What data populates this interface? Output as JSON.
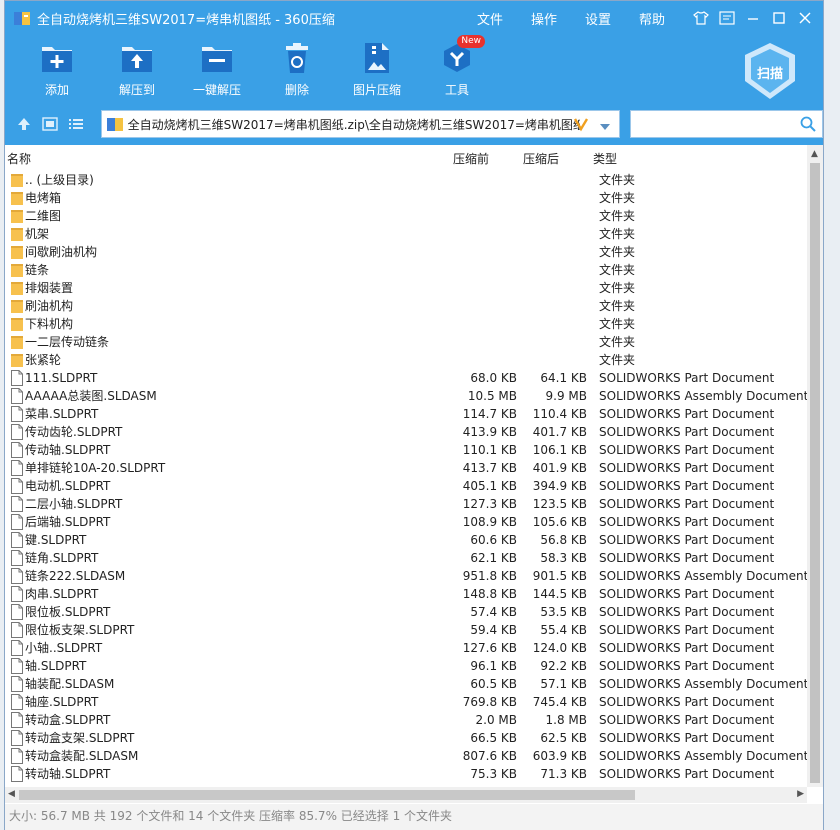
{
  "window": {
    "title": "全自动烧烤机三维SW2017=烤串机图纸 - 360压缩",
    "menu": [
      "文件",
      "操作",
      "设置",
      "帮助"
    ]
  },
  "toolbar": {
    "add_label": "添加",
    "extract_to_label": "解压到",
    "one_click_extract_label": "一键解压",
    "delete_label": "删除",
    "image_compress_label": "图片压缩",
    "tools_label": "工具",
    "tools_badge": "New",
    "scan_label": "扫描"
  },
  "address": {
    "path": "全自动烧烤机三维SW2017=烤串机图纸.zip\\全自动烧烤机三维SW2017=烤串机图纸",
    "search_placeholder": ""
  },
  "columns": {
    "name": "名称",
    "before": "压缩前",
    "after": "压缩后",
    "type": "类型"
  },
  "rows": [
    {
      "name": ".. (上级目录)",
      "before": "",
      "after": "",
      "type": "文件夹",
      "kind": "folder"
    },
    {
      "name": "电烤箱",
      "before": "",
      "after": "",
      "type": "文件夹",
      "kind": "folder"
    },
    {
      "name": "二维图",
      "before": "",
      "after": "",
      "type": "文件夹",
      "kind": "folder"
    },
    {
      "name": "机架",
      "before": "",
      "after": "",
      "type": "文件夹",
      "kind": "folder"
    },
    {
      "name": "间歇刷油机构",
      "before": "",
      "after": "",
      "type": "文件夹",
      "kind": "folder"
    },
    {
      "name": "链条",
      "before": "",
      "after": "",
      "type": "文件夹",
      "kind": "folder"
    },
    {
      "name": "排烟装置",
      "before": "",
      "after": "",
      "type": "文件夹",
      "kind": "folder"
    },
    {
      "name": "刷油机构",
      "before": "",
      "after": "",
      "type": "文件夹",
      "kind": "folder"
    },
    {
      "name": "下料机构",
      "before": "",
      "after": "",
      "type": "文件夹",
      "kind": "folder"
    },
    {
      "name": "一二层传动链条",
      "before": "",
      "after": "",
      "type": "文件夹",
      "kind": "folder"
    },
    {
      "name": "张紧轮",
      "before": "",
      "after": "",
      "type": "文件夹",
      "kind": "folder"
    },
    {
      "name": "111.SLDPRT",
      "before": "68.0 KB",
      "after": "64.1 KB",
      "type": "SOLIDWORKS Part Document",
      "kind": "file"
    },
    {
      "name": "AAAAA总装图.SLDASM",
      "before": "10.5 MB",
      "after": "9.9 MB",
      "type": "SOLIDWORKS Assembly Document",
      "kind": "file"
    },
    {
      "name": "菜串.SLDPRT",
      "before": "114.7 KB",
      "after": "110.4 KB",
      "type": "SOLIDWORKS Part Document",
      "kind": "file"
    },
    {
      "name": "传动齿轮.SLDPRT",
      "before": "413.9 KB",
      "after": "401.7 KB",
      "type": "SOLIDWORKS Part Document",
      "kind": "file"
    },
    {
      "name": "传动轴.SLDPRT",
      "before": "110.1 KB",
      "after": "106.1 KB",
      "type": "SOLIDWORKS Part Document",
      "kind": "file"
    },
    {
      "name": "单排链轮10A-20.SLDPRT",
      "before": "413.7 KB",
      "after": "401.9 KB",
      "type": "SOLIDWORKS Part Document",
      "kind": "file"
    },
    {
      "name": "电动机.SLDPRT",
      "before": "405.1 KB",
      "after": "394.9 KB",
      "type": "SOLIDWORKS Part Document",
      "kind": "file"
    },
    {
      "name": "二层小轴.SLDPRT",
      "before": "127.3 KB",
      "after": "123.5 KB",
      "type": "SOLIDWORKS Part Document",
      "kind": "file"
    },
    {
      "name": "后端轴.SLDPRT",
      "before": "108.9 KB",
      "after": "105.6 KB",
      "type": "SOLIDWORKS Part Document",
      "kind": "file"
    },
    {
      "name": "键.SLDPRT",
      "before": "60.6 KB",
      "after": "56.8 KB",
      "type": "SOLIDWORKS Part Document",
      "kind": "file"
    },
    {
      "name": "链角.SLDPRT",
      "before": "62.1 KB",
      "after": "58.3 KB",
      "type": "SOLIDWORKS Part Document",
      "kind": "file"
    },
    {
      "name": "链条222.SLDASM",
      "before": "951.8 KB",
      "after": "901.5 KB",
      "type": "SOLIDWORKS Assembly Document",
      "kind": "file"
    },
    {
      "name": "肉串.SLDPRT",
      "before": "148.8 KB",
      "after": "144.5 KB",
      "type": "SOLIDWORKS Part Document",
      "kind": "file"
    },
    {
      "name": "限位板.SLDPRT",
      "before": "57.4 KB",
      "after": "53.5 KB",
      "type": "SOLIDWORKS Part Document",
      "kind": "file"
    },
    {
      "name": "限位板支架.SLDPRT",
      "before": "59.4 KB",
      "after": "55.4 KB",
      "type": "SOLIDWORKS Part Document",
      "kind": "file"
    },
    {
      "name": "小轴..SLDPRT",
      "before": "127.6 KB",
      "after": "124.0 KB",
      "type": "SOLIDWORKS Part Document",
      "kind": "file"
    },
    {
      "name": "轴.SLDPRT",
      "before": "96.1 KB",
      "after": "92.2 KB",
      "type": "SOLIDWORKS Part Document",
      "kind": "file"
    },
    {
      "name": "轴装配.SLDASM",
      "before": "60.5 KB",
      "after": "57.1 KB",
      "type": "SOLIDWORKS Assembly Document",
      "kind": "file"
    },
    {
      "name": "轴座.SLDPRT",
      "before": "769.8 KB",
      "after": "745.4 KB",
      "type": "SOLIDWORKS Part Document",
      "kind": "file"
    },
    {
      "name": "转动盒.SLDPRT",
      "before": "2.0 MB",
      "after": "1.8 MB",
      "type": "SOLIDWORKS Part Document",
      "kind": "file"
    },
    {
      "name": "转动盒支架.SLDPRT",
      "before": "66.5 KB",
      "after": "62.5 KB",
      "type": "SOLIDWORKS Part Document",
      "kind": "file"
    },
    {
      "name": "转动盒装配.SLDASM",
      "before": "807.6 KB",
      "after": "603.9 KB",
      "type": "SOLIDWORKS Assembly Document",
      "kind": "file"
    },
    {
      "name": "转动轴.SLDPRT",
      "before": "75.3 KB",
      "after": "71.3 KB",
      "type": "SOLIDWORKS Part Document",
      "kind": "file"
    }
  ],
  "status": {
    "text": "大小: 56.7 MB 共 192 个文件和 14 个文件夹 压缩率 85.7% 已经选择 1 个文件夹"
  },
  "colors": {
    "titlebar": "#3aa0e6",
    "folder": "#f7c14e"
  }
}
